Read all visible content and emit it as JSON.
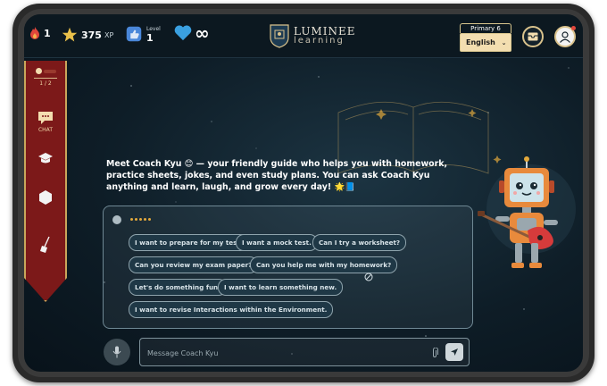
{
  "topbar": {
    "streak_count": "1",
    "xp_value": "375",
    "xp_unit": "XP",
    "level_label": "Level",
    "level_value": "1",
    "lives_value": "∞",
    "logo_title": "LUMINEE",
    "logo_subtitle": "learning",
    "grade_label": "Primary 6",
    "language_value": "English",
    "icons": [
      "flame-icon",
      "star-icon",
      "thumbs-up-icon",
      "heart-icon",
      "inbox-icon",
      "avatar-icon"
    ]
  },
  "sidebar": {
    "page_indicator": "1 / 2",
    "chat_label": "CHAT",
    "items": [
      "chat-icon",
      "graduation-cap-icon",
      "hexagon-icon",
      "broom-icon"
    ]
  },
  "chat": {
    "coach_message": "Meet Coach Kyu 😊 — your friendly guide who helps you with homework, practice sheets, jokes, and even study plans. You can ask Coach Kyu anything and learn, laugh, and grow every day! 🌟📘",
    "suggestions": [
      "I want to prepare for my test.",
      "I want a mock test.",
      "Can I try a worksheet?",
      "Can you review my exam paper?",
      "Can you help me with my homework?",
      "Let's do something fun!",
      "I want to learn something new.",
      "I want to revise Interactions within the Environment."
    ]
  },
  "input": {
    "placeholder": "Message Coach Kyu"
  },
  "colors": {
    "accent_gold": "#d9c28c",
    "banner_red": "#7c1919",
    "background": "#0e1d27"
  }
}
